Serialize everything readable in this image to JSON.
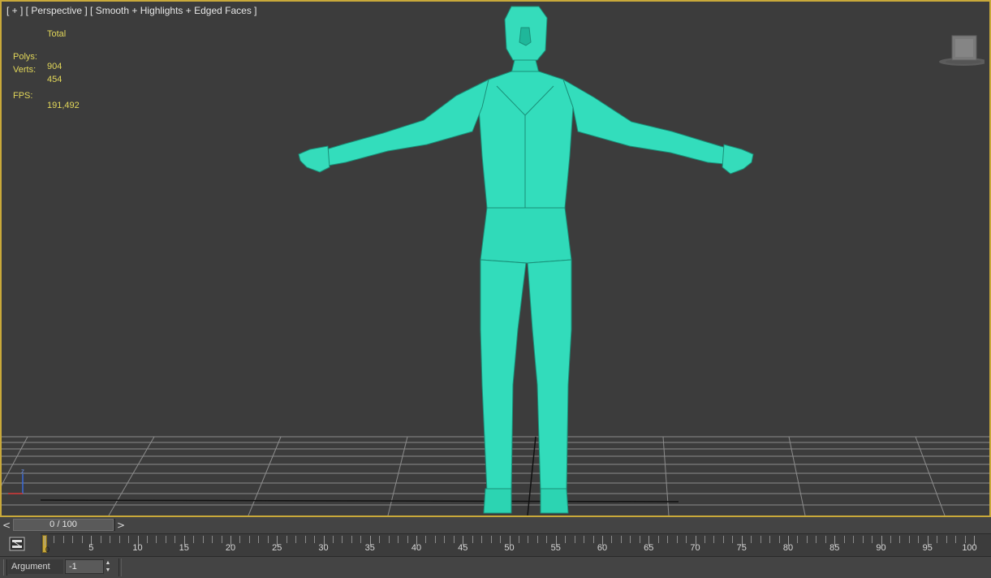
{
  "viewport": {
    "label": "[ + ] [ Perspective ] [ Smooth + Highlights + Edged Faces ]",
    "border_color": "#c9a93a",
    "background": "#3c3c3c",
    "model_color": "#2fd8b6",
    "stats": {
      "header": "Total",
      "polys_label": "Polys:",
      "polys_value": "904",
      "verts_label": "Verts:",
      "verts_value": "454",
      "fps_label": "FPS:",
      "fps_value": "191,492"
    },
    "axis_gizmo": {
      "z_label": "z"
    }
  },
  "time_slider": {
    "prev_label": "<",
    "next_label": ">",
    "frame_display": "0 / 100",
    "current_frame": 0,
    "total_frames": 100
  },
  "trackbar": {
    "tick_labels": [
      "0",
      "5",
      "10",
      "15",
      "20",
      "25",
      "30",
      "35",
      "40",
      "45",
      "50",
      "55",
      "60",
      "65",
      "70",
      "75",
      "80",
      "85",
      "90",
      "95",
      "100"
    ],
    "current_frame_label": "0"
  },
  "statusbar": {
    "field_label": "Argument",
    "field_value": "-1",
    "spinner_up": "▲",
    "spinner_down": "▼"
  }
}
